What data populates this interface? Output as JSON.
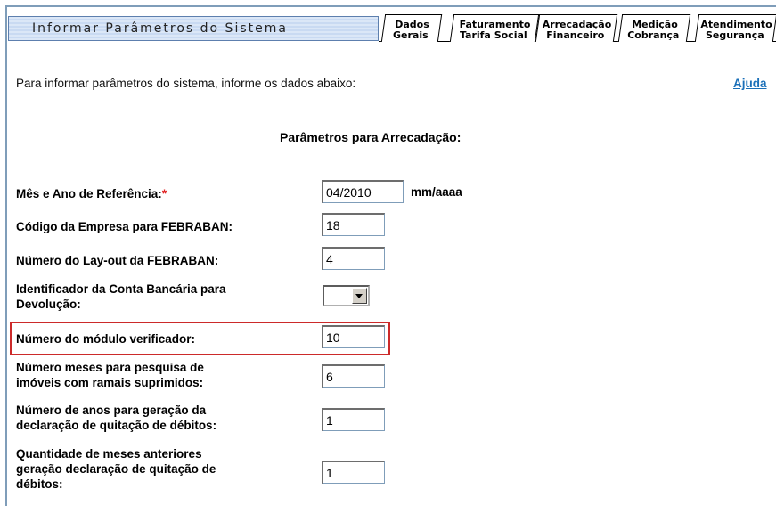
{
  "header": {
    "title": "Informar Parâmetros do Sistema"
  },
  "tabs": [
    {
      "line1": "Dados",
      "line2": "Gerais"
    },
    {
      "line1": "Faturamento",
      "line2": "Tarifa Social"
    },
    {
      "line1": "Arrecadação",
      "line2": "Financeiro"
    },
    {
      "line1": "Medição",
      "line2": "Cobrança"
    },
    {
      "line1": "Atendimento",
      "line2": "Segurança"
    }
  ],
  "intro": {
    "text": "Para informar parâmetros do sistema, informe os dados abaixo:",
    "help": "Ajuda"
  },
  "section": {
    "title": "Parâmetros para Arrecadação:"
  },
  "form": {
    "mes_ano": {
      "label": "Mês e Ano de Referência:",
      "required": "*",
      "value": "04/2010",
      "unit": "mm/aaaa"
    },
    "codigo_empresa": {
      "label": "Código da Empresa para FEBRABAN:",
      "value": "18"
    },
    "layout": {
      "label": "Número do Lay-out da FEBRABAN:",
      "value": "4"
    },
    "conta_bancaria": {
      "label_line1": "Identificador da Conta Bancária para",
      "label_line2": "Devolução:",
      "value": ""
    },
    "modulo": {
      "label": "Número do módulo verificador:",
      "value": "10"
    },
    "meses_pesquisa": {
      "label_line1": "Número meses para pesquisa de",
      "label_line2": "imóveis com ramais suprimidos:",
      "value": "6"
    },
    "anos_geracao": {
      "label_line1": "Número de anos para geração da",
      "label_line2": "declaração de quitação de débitos:",
      "value": "1"
    },
    "meses_anteriores": {
      "label_line1": "Quantidade de meses anteriores",
      "label_line2": "geração declaração de quitação de",
      "label_line3": "débitos:",
      "value": "1"
    }
  }
}
